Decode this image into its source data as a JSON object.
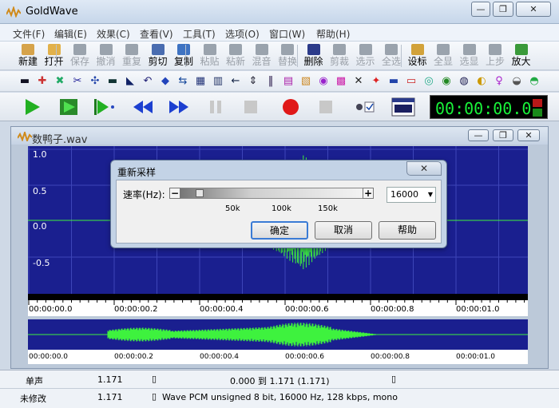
{
  "app": {
    "title": "GoldWave"
  },
  "window_buttons": {
    "minimize": "—",
    "restore": "❐",
    "close": "✕"
  },
  "menu": [
    "文件(F)",
    "编辑(E)",
    "效果(C)",
    "查看(V)",
    "工具(T)",
    "选项(O)",
    "窗口(W)",
    "帮助(H)"
  ],
  "toolbar": [
    {
      "label": "新建",
      "enabled": true,
      "color": "#d6a34a"
    },
    {
      "label": "打开",
      "enabled": true,
      "color": "#e2b14a"
    },
    {
      "label": "保存",
      "enabled": false,
      "color": "#9aa3ad"
    },
    {
      "label": "撤消",
      "enabled": false,
      "color": "#9aa3ad"
    },
    {
      "label": "重复",
      "enabled": false,
      "color": "#9aa3ad"
    },
    {
      "label": "剪切",
      "enabled": true,
      "color": "#4a6db0"
    },
    {
      "label": "复制",
      "enabled": true,
      "color": "#3e73c2"
    },
    {
      "label": "粘贴",
      "enabled": false,
      "color": "#9aa3ad"
    },
    {
      "label": "粘新",
      "enabled": false,
      "color": "#9aa3ad"
    },
    {
      "label": "混音",
      "enabled": false,
      "color": "#9aa3ad"
    },
    {
      "label": "替换",
      "enabled": false,
      "color": "#9aa3ad"
    },
    {
      "label": "删除",
      "enabled": true,
      "color": "#2c3b8a"
    },
    {
      "label": "剪裁",
      "enabled": false,
      "color": "#9aa3ad"
    },
    {
      "label": "选示",
      "enabled": false,
      "color": "#9aa3ad"
    },
    {
      "label": "全选",
      "enabled": false,
      "color": "#9aa3ad"
    },
    {
      "label": "设标",
      "enabled": true,
      "color": "#d2a23a"
    },
    {
      "label": "全显",
      "enabled": false,
      "color": "#9aa3ad"
    },
    {
      "label": "选显",
      "enabled": false,
      "color": "#9aa3ad"
    },
    {
      "label": "上步",
      "enabled": false,
      "color": "#9aa3ad"
    },
    {
      "label": "放大",
      "enabled": true,
      "color": "#3a9a3a"
    }
  ],
  "toolbar2_icons": [
    "▬",
    "✚",
    "✖",
    "✂",
    "✣",
    "▬",
    "◣",
    "↶",
    "◆",
    "⇆",
    "▦",
    "▥",
    "←",
    "⇕",
    "‖",
    "▤",
    "▧",
    "◉",
    "▩",
    "✕",
    "✦",
    "▬",
    "▭",
    "◎",
    "◉",
    "◍",
    "◐",
    "♀",
    "◒",
    "◓"
  ],
  "transport": {
    "time": "00:00:00.0"
  },
  "document": {
    "title": "数鸭子.wav"
  },
  "waveform": {
    "y_labels": [
      "1.0",
      "0.5",
      "0.0",
      "-0.5"
    ],
    "time_ticks": [
      "00:00:00.0",
      "00:00:00.2",
      "00:00:00.4",
      "00:00:00.6",
      "00:00:00.8",
      "00:00:01.0"
    ],
    "overview_ticks": [
      "00:00:00.0",
      "00:00:00.2",
      "00:00:00.4",
      "00:00:00.6",
      "00:00:00.8",
      "00:00:01.0"
    ],
    "colors": {
      "background": "#1a1f8f",
      "wave": "#3ef23e",
      "grid": "#3d45b8"
    }
  },
  "status": {
    "row1": {
      "channel": "单声",
      "length": "1.171",
      "selection": "0.000 到 1.171 (1.171)"
    },
    "row2": {
      "state": "未修改",
      "length": "1.171",
      "format": "Wave PCM unsigned 8 bit, 16000 Hz, 128 kbps, mono"
    }
  },
  "dialog": {
    "title": "重新采样",
    "close": "✕",
    "rate_label": "速率(Hz):",
    "minus": "−",
    "plus": "+",
    "slider_ticks": [
      "50k",
      "100k",
      "150k"
    ],
    "rate_value": "16000",
    "ok": "确定",
    "cancel": "取消",
    "help": "帮助"
  }
}
